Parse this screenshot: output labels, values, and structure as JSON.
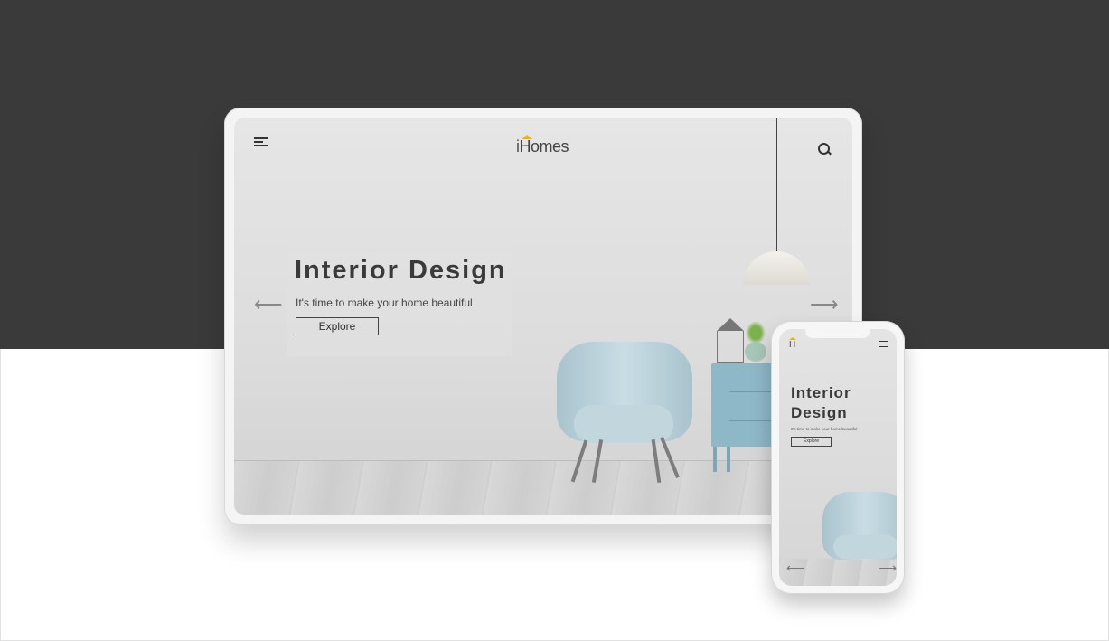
{
  "tablet": {
    "logo": "Homes",
    "logo_prefix": "i",
    "hero_title": "Interior Design",
    "hero_subtitle": "It's time to make your home beautiful",
    "explore_label": "Explore",
    "arrow_left": "⟵",
    "arrow_right": "⟶"
  },
  "phone": {
    "logo": "H",
    "hero_title": "Interior Design",
    "hero_subtitle": "It's time to make your home beautiful",
    "explore_label": "Explore",
    "arrow_left": "⟵",
    "arrow_right": "⟶"
  },
  "colors": {
    "background_dark": "#3a3a3a",
    "accent_roof": "#f0b400",
    "cabinet": "#8eb7c7",
    "chair": "#c2d6dd"
  },
  "icons": {
    "menu": "hamburger-menu-icon",
    "search": "search-icon",
    "arrow_left": "arrow-left-icon",
    "arrow_right": "arrow-right-icon"
  }
}
